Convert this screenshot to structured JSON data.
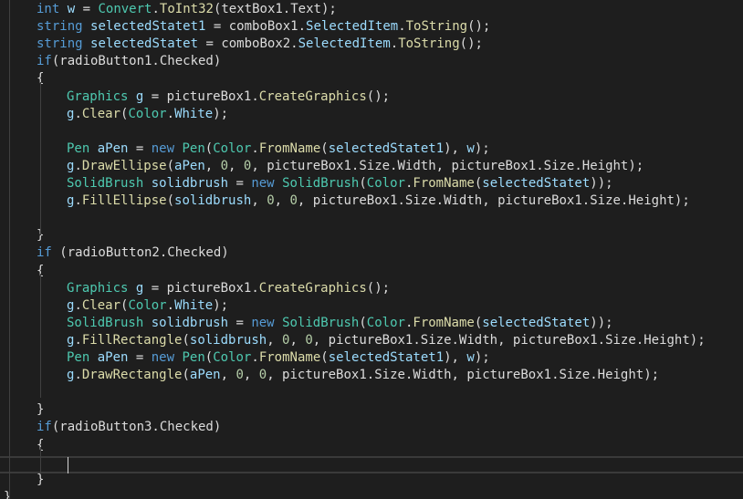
{
  "colors": {
    "background": "#1e1e1e",
    "keyword": "#569cd6",
    "type": "#4ec9b0",
    "method": "#dcdcaa",
    "variable": "#9cdcfe",
    "number": "#b5cea8",
    "plain": "#dcdcdc"
  },
  "editor": {
    "lines": [
      {
        "indent": 1,
        "tokens": [
          [
            "kw",
            "int"
          ],
          [
            "p",
            " "
          ],
          [
            "var",
            "w"
          ],
          [
            "p",
            " = "
          ],
          [
            "type",
            "Convert"
          ],
          [
            "p",
            "."
          ],
          [
            "meth",
            "ToInt32"
          ],
          [
            "p",
            "(textBox1.Text);"
          ]
        ]
      },
      {
        "indent": 1,
        "tokens": [
          [
            "kw",
            "string"
          ],
          [
            "p",
            " "
          ],
          [
            "var",
            "selectedStatet1"
          ],
          [
            "p",
            " = comboBox1."
          ],
          [
            "var",
            "SelectedItem"
          ],
          [
            "p",
            "."
          ],
          [
            "meth",
            "ToString"
          ],
          [
            "p",
            "();"
          ]
        ]
      },
      {
        "indent": 1,
        "tokens": [
          [
            "kw",
            "string"
          ],
          [
            "p",
            " "
          ],
          [
            "var",
            "selectedStatet"
          ],
          [
            "p",
            " = comboBox2."
          ],
          [
            "var",
            "SelectedItem"
          ],
          [
            "p",
            "."
          ],
          [
            "meth",
            "ToString"
          ],
          [
            "p",
            "();"
          ]
        ]
      },
      {
        "indent": 1,
        "tokens": [
          [
            "kw",
            "if"
          ],
          [
            "p",
            "(radioButton1.Checked)"
          ]
        ]
      },
      {
        "indent": 1,
        "tokens": [
          [
            "p",
            "{"
          ]
        ]
      },
      {
        "indent": 2,
        "tokens": [
          [
            "type",
            "Graphics"
          ],
          [
            "p",
            " "
          ],
          [
            "var",
            "g"
          ],
          [
            "p",
            " = pictureBox1."
          ],
          [
            "meth",
            "CreateGraphics"
          ],
          [
            "p",
            "();"
          ]
        ]
      },
      {
        "indent": 2,
        "tokens": [
          [
            "var",
            "g"
          ],
          [
            "p",
            "."
          ],
          [
            "meth",
            "Clear"
          ],
          [
            "p",
            "("
          ],
          [
            "type",
            "Color"
          ],
          [
            "p",
            "."
          ],
          [
            "var",
            "White"
          ],
          [
            "p",
            ");"
          ]
        ]
      },
      {
        "indent": 2,
        "tokens": []
      },
      {
        "indent": 2,
        "tokens": [
          [
            "type",
            "Pen"
          ],
          [
            "p",
            " "
          ],
          [
            "var",
            "aPen"
          ],
          [
            "p",
            " = "
          ],
          [
            "kw",
            "new"
          ],
          [
            "p",
            " "
          ],
          [
            "type",
            "Pen"
          ],
          [
            "p",
            "("
          ],
          [
            "type",
            "Color"
          ],
          [
            "p",
            "."
          ],
          [
            "meth",
            "FromName"
          ],
          [
            "p",
            "("
          ],
          [
            "var",
            "selectedStatet1"
          ],
          [
            "p",
            "), "
          ],
          [
            "var",
            "w"
          ],
          [
            "p",
            ");"
          ]
        ]
      },
      {
        "indent": 2,
        "tokens": [
          [
            "var",
            "g"
          ],
          [
            "p",
            "."
          ],
          [
            "meth",
            "DrawEllipse"
          ],
          [
            "p",
            "("
          ],
          [
            "var",
            "aPen"
          ],
          [
            "p",
            ", "
          ],
          [
            "num",
            "0"
          ],
          [
            "p",
            ", "
          ],
          [
            "num",
            "0"
          ],
          [
            "p",
            ", pictureBox1.Size.Width, pictureBox1.Size.Height);"
          ]
        ]
      },
      {
        "indent": 2,
        "tokens": [
          [
            "type",
            "SolidBrush"
          ],
          [
            "p",
            " "
          ],
          [
            "var",
            "solidbrush"
          ],
          [
            "p",
            " = "
          ],
          [
            "kw",
            "new"
          ],
          [
            "p",
            " "
          ],
          [
            "type",
            "SolidBrush"
          ],
          [
            "p",
            "("
          ],
          [
            "type",
            "Color"
          ],
          [
            "p",
            "."
          ],
          [
            "meth",
            "FromName"
          ],
          [
            "p",
            "("
          ],
          [
            "var",
            "selectedStatet"
          ],
          [
            "p",
            "));"
          ]
        ]
      },
      {
        "indent": 2,
        "tokens": [
          [
            "var",
            "g"
          ],
          [
            "p",
            "."
          ],
          [
            "meth",
            "FillEllipse"
          ],
          [
            "p",
            "("
          ],
          [
            "var",
            "solidbrush"
          ],
          [
            "p",
            ", "
          ],
          [
            "num",
            "0"
          ],
          [
            "p",
            ", "
          ],
          [
            "num",
            "0"
          ],
          [
            "p",
            ", pictureBox1.Size.Width, pictureBox1.Size.Height);"
          ]
        ]
      },
      {
        "indent": 2,
        "tokens": []
      },
      {
        "indent": 1,
        "tokens": [
          [
            "p",
            "}"
          ]
        ]
      },
      {
        "indent": 1,
        "tokens": [
          [
            "kw",
            "if"
          ],
          [
            "p",
            " (radioButton2.Checked)"
          ]
        ]
      },
      {
        "indent": 1,
        "tokens": [
          [
            "p",
            "{"
          ]
        ]
      },
      {
        "indent": 2,
        "tokens": [
          [
            "type",
            "Graphics"
          ],
          [
            "p",
            " "
          ],
          [
            "var",
            "g"
          ],
          [
            "p",
            " = pictureBox1."
          ],
          [
            "meth",
            "CreateGraphics"
          ],
          [
            "p",
            "();"
          ]
        ]
      },
      {
        "indent": 2,
        "tokens": [
          [
            "var",
            "g"
          ],
          [
            "p",
            "."
          ],
          [
            "meth",
            "Clear"
          ],
          [
            "p",
            "("
          ],
          [
            "type",
            "Color"
          ],
          [
            "p",
            "."
          ],
          [
            "var",
            "White"
          ],
          [
            "p",
            ");"
          ]
        ]
      },
      {
        "indent": 2,
        "tokens": [
          [
            "type",
            "SolidBrush"
          ],
          [
            "p",
            " "
          ],
          [
            "var",
            "solidbrush"
          ],
          [
            "p",
            " = "
          ],
          [
            "kw",
            "new"
          ],
          [
            "p",
            " "
          ],
          [
            "type",
            "SolidBrush"
          ],
          [
            "p",
            "("
          ],
          [
            "type",
            "Color"
          ],
          [
            "p",
            "."
          ],
          [
            "meth",
            "FromName"
          ],
          [
            "p",
            "("
          ],
          [
            "var",
            "selectedStatet"
          ],
          [
            "p",
            "));"
          ]
        ]
      },
      {
        "indent": 2,
        "tokens": [
          [
            "var",
            "g"
          ],
          [
            "p",
            "."
          ],
          [
            "meth",
            "FillRectangle"
          ],
          [
            "p",
            "("
          ],
          [
            "var",
            "solidbrush"
          ],
          [
            "p",
            ", "
          ],
          [
            "num",
            "0"
          ],
          [
            "p",
            ", "
          ],
          [
            "num",
            "0"
          ],
          [
            "p",
            ", pictureBox1.Size.Width, pictureBox1.Size.Height);"
          ]
        ]
      },
      {
        "indent": 2,
        "tokens": [
          [
            "type",
            "Pen"
          ],
          [
            "p",
            " "
          ],
          [
            "var",
            "aPen"
          ],
          [
            "p",
            " = "
          ],
          [
            "kw",
            "new"
          ],
          [
            "p",
            " "
          ],
          [
            "type",
            "Pen"
          ],
          [
            "p",
            "("
          ],
          [
            "type",
            "Color"
          ],
          [
            "p",
            "."
          ],
          [
            "meth",
            "FromName"
          ],
          [
            "p",
            "("
          ],
          [
            "var",
            "selectedStatet1"
          ],
          [
            "p",
            "), "
          ],
          [
            "var",
            "w"
          ],
          [
            "p",
            ");"
          ]
        ]
      },
      {
        "indent": 2,
        "tokens": [
          [
            "var",
            "g"
          ],
          [
            "p",
            "."
          ],
          [
            "meth",
            "DrawRectangle"
          ],
          [
            "p",
            "("
          ],
          [
            "var",
            "aPen"
          ],
          [
            "p",
            ", "
          ],
          [
            "num",
            "0"
          ],
          [
            "p",
            ", "
          ],
          [
            "num",
            "0"
          ],
          [
            "p",
            ", pictureBox1.Size.Width, pictureBox1.Size.Height);"
          ]
        ]
      },
      {
        "indent": 2,
        "tokens": []
      },
      {
        "indent": 1,
        "tokens": [
          [
            "p",
            "}"
          ]
        ]
      },
      {
        "indent": 1,
        "tokens": [
          [
            "kw",
            "if"
          ],
          [
            "p",
            "(radioButton3.Checked)"
          ]
        ]
      },
      {
        "indent": 1,
        "tokens": [
          [
            "p",
            "{"
          ]
        ]
      },
      {
        "indent": 2,
        "tokens": []
      },
      {
        "indent": 1,
        "tokens": [
          [
            "p",
            "}"
          ]
        ]
      },
      {
        "indent": 0,
        "tokens": [
          [
            "p",
            "}"
          ]
        ]
      }
    ]
  }
}
